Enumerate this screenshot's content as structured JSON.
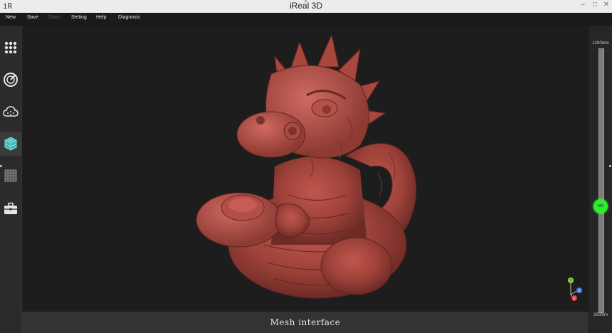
{
  "window": {
    "title": "iReal 3D",
    "logo": "iR",
    "minimize": "–",
    "maximize": "□",
    "close": "✕"
  },
  "menu": [
    {
      "label": "New",
      "enabled": true
    },
    {
      "label": "Save",
      "enabled": true
    },
    {
      "label": "Open",
      "enabled": false
    },
    {
      "label": "Setting",
      "enabled": true
    },
    {
      "label": "Help",
      "enabled": true
    },
    {
      "label": "Diagnosis",
      "enabled": true
    }
  ],
  "sidebar_tools": [
    {
      "icon": "grid-dots-icon",
      "active": false
    },
    {
      "icon": "scan-target-icon",
      "active": false
    },
    {
      "icon": "cloud-points-icon",
      "active": false
    },
    {
      "icon": "mesh-cube-icon",
      "active": true
    },
    {
      "icon": "grid-panel-icon",
      "active": false
    },
    {
      "icon": "toolbox-icon",
      "active": false
    }
  ],
  "footer": {
    "label": "Mesh interface"
  },
  "depth_slider": {
    "max_label": "1200mm",
    "min_label": "200mm",
    "knob_label": "600",
    "level_fraction": 0.4
  },
  "axes": {
    "y": "Y",
    "z": "Z",
    "x": "X"
  },
  "colors": {
    "model": "#a2473f",
    "accent": "#2cf02c",
    "active_icon": "#4fc3c8"
  }
}
